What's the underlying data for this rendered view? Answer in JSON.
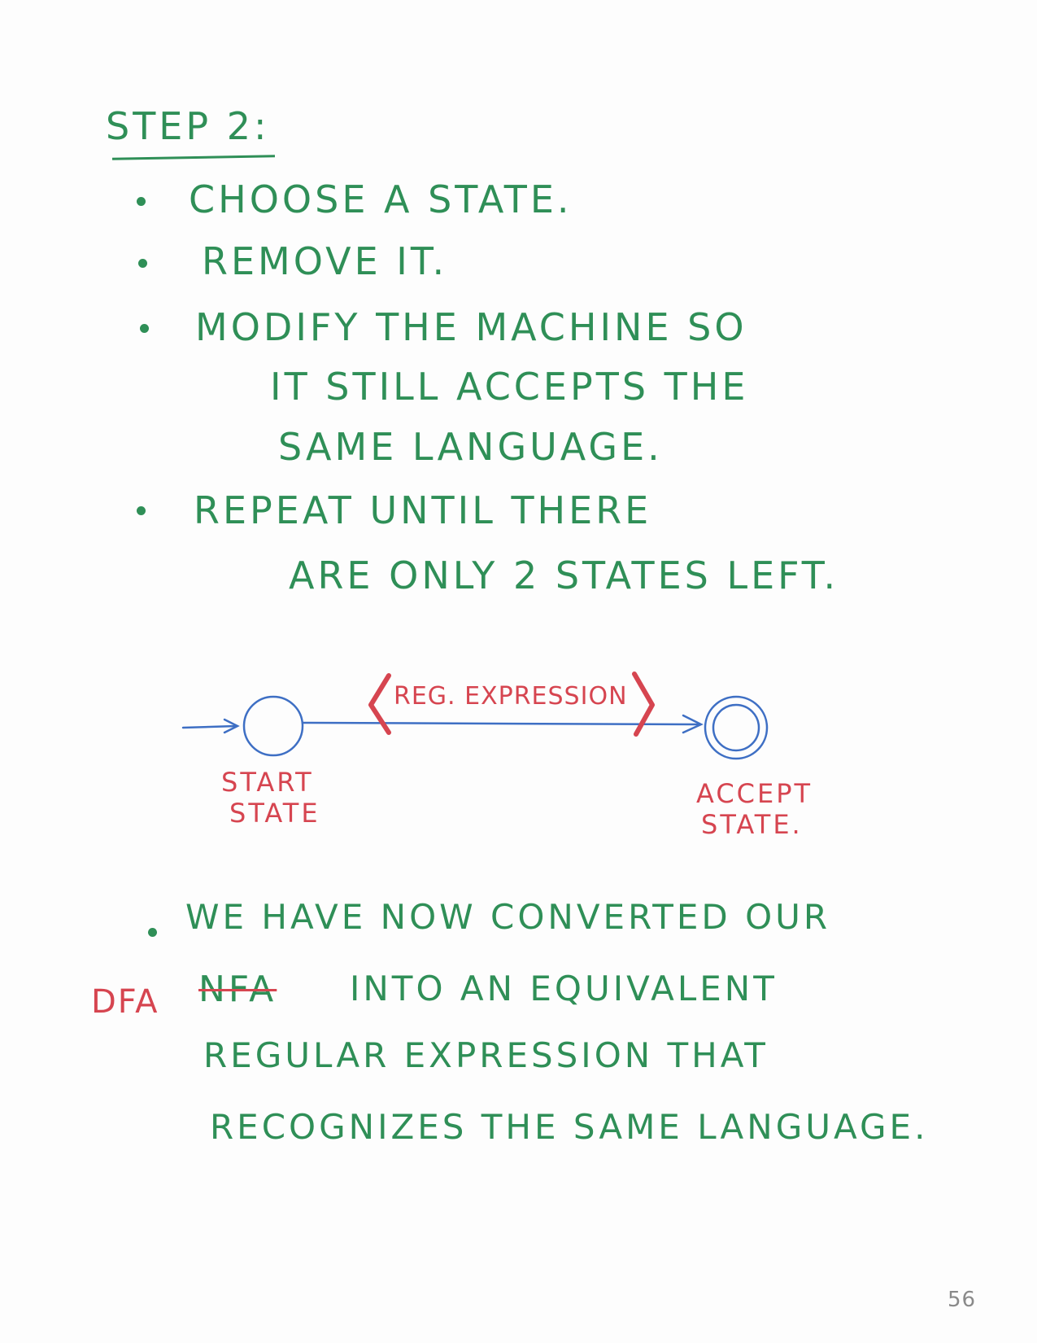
{
  "heading": "STEP 2:",
  "steps": [
    {
      "lines": [
        "CHOOSE  A  STATE."
      ]
    },
    {
      "lines": [
        "REMOVE  IT."
      ]
    },
    {
      "lines": [
        "MODIFY  THE  MACHINE  SO",
        "IT  STILL  ACCEPTS  THE",
        "SAME  LANGUAGE."
      ]
    },
    {
      "lines": [
        "REPEAT  UNTIL  THERE",
        "ARE  ONLY  2  STATES LEFT."
      ]
    }
  ],
  "diagram": {
    "edge_label": "REG. EXPRESSION",
    "start_label": [
      "START",
      "STATE"
    ],
    "accept_label": [
      "ACCEPT",
      "STATE."
    ]
  },
  "conclusion": {
    "line1": "WE  HAVE  NOW  CONVERTED  OUR",
    "correction": "DFA",
    "struck_word": "NFA",
    "line2_rest": "INTO  AN  EQUIVALENT",
    "line3": "REGULAR  EXPRESSION  THAT",
    "line4": "RECOGNIZES  THE  SAME  LANGUAGE."
  },
  "page_number": "56",
  "colors": {
    "green_ink": "#2f8f57",
    "red_ink": "#d64550",
    "blue_ink": "#3e6fc4"
  }
}
